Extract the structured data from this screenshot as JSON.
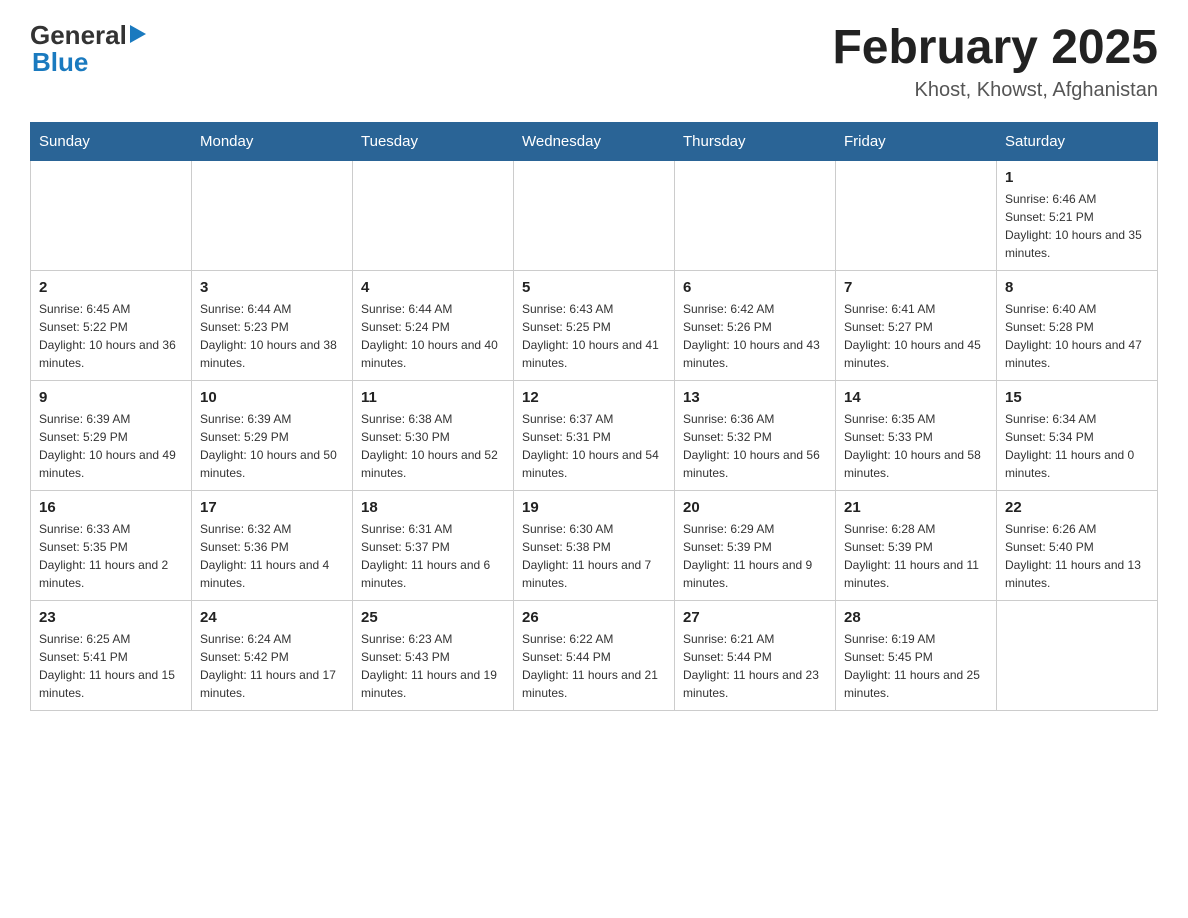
{
  "header": {
    "logo_general": "General",
    "logo_blue": "Blue",
    "title": "February 2025",
    "subtitle": "Khost, Khowst, Afghanistan"
  },
  "days_of_week": [
    "Sunday",
    "Monday",
    "Tuesday",
    "Wednesday",
    "Thursday",
    "Friday",
    "Saturday"
  ],
  "weeks": [
    {
      "days": [
        {
          "number": "",
          "info": ""
        },
        {
          "number": "",
          "info": ""
        },
        {
          "number": "",
          "info": ""
        },
        {
          "number": "",
          "info": ""
        },
        {
          "number": "",
          "info": ""
        },
        {
          "number": "",
          "info": ""
        },
        {
          "number": "1",
          "info": "Sunrise: 6:46 AM\nSunset: 5:21 PM\nDaylight: 10 hours and 35 minutes."
        }
      ]
    },
    {
      "days": [
        {
          "number": "2",
          "info": "Sunrise: 6:45 AM\nSunset: 5:22 PM\nDaylight: 10 hours and 36 minutes."
        },
        {
          "number": "3",
          "info": "Sunrise: 6:44 AM\nSunset: 5:23 PM\nDaylight: 10 hours and 38 minutes."
        },
        {
          "number": "4",
          "info": "Sunrise: 6:44 AM\nSunset: 5:24 PM\nDaylight: 10 hours and 40 minutes."
        },
        {
          "number": "5",
          "info": "Sunrise: 6:43 AM\nSunset: 5:25 PM\nDaylight: 10 hours and 41 minutes."
        },
        {
          "number": "6",
          "info": "Sunrise: 6:42 AM\nSunset: 5:26 PM\nDaylight: 10 hours and 43 minutes."
        },
        {
          "number": "7",
          "info": "Sunrise: 6:41 AM\nSunset: 5:27 PM\nDaylight: 10 hours and 45 minutes."
        },
        {
          "number": "8",
          "info": "Sunrise: 6:40 AM\nSunset: 5:28 PM\nDaylight: 10 hours and 47 minutes."
        }
      ]
    },
    {
      "days": [
        {
          "number": "9",
          "info": "Sunrise: 6:39 AM\nSunset: 5:29 PM\nDaylight: 10 hours and 49 minutes."
        },
        {
          "number": "10",
          "info": "Sunrise: 6:39 AM\nSunset: 5:29 PM\nDaylight: 10 hours and 50 minutes."
        },
        {
          "number": "11",
          "info": "Sunrise: 6:38 AM\nSunset: 5:30 PM\nDaylight: 10 hours and 52 minutes."
        },
        {
          "number": "12",
          "info": "Sunrise: 6:37 AM\nSunset: 5:31 PM\nDaylight: 10 hours and 54 minutes."
        },
        {
          "number": "13",
          "info": "Sunrise: 6:36 AM\nSunset: 5:32 PM\nDaylight: 10 hours and 56 minutes."
        },
        {
          "number": "14",
          "info": "Sunrise: 6:35 AM\nSunset: 5:33 PM\nDaylight: 10 hours and 58 minutes."
        },
        {
          "number": "15",
          "info": "Sunrise: 6:34 AM\nSunset: 5:34 PM\nDaylight: 11 hours and 0 minutes."
        }
      ]
    },
    {
      "days": [
        {
          "number": "16",
          "info": "Sunrise: 6:33 AM\nSunset: 5:35 PM\nDaylight: 11 hours and 2 minutes."
        },
        {
          "number": "17",
          "info": "Sunrise: 6:32 AM\nSunset: 5:36 PM\nDaylight: 11 hours and 4 minutes."
        },
        {
          "number": "18",
          "info": "Sunrise: 6:31 AM\nSunset: 5:37 PM\nDaylight: 11 hours and 6 minutes."
        },
        {
          "number": "19",
          "info": "Sunrise: 6:30 AM\nSunset: 5:38 PM\nDaylight: 11 hours and 7 minutes."
        },
        {
          "number": "20",
          "info": "Sunrise: 6:29 AM\nSunset: 5:39 PM\nDaylight: 11 hours and 9 minutes."
        },
        {
          "number": "21",
          "info": "Sunrise: 6:28 AM\nSunset: 5:39 PM\nDaylight: 11 hours and 11 minutes."
        },
        {
          "number": "22",
          "info": "Sunrise: 6:26 AM\nSunset: 5:40 PM\nDaylight: 11 hours and 13 minutes."
        }
      ]
    },
    {
      "days": [
        {
          "number": "23",
          "info": "Sunrise: 6:25 AM\nSunset: 5:41 PM\nDaylight: 11 hours and 15 minutes."
        },
        {
          "number": "24",
          "info": "Sunrise: 6:24 AM\nSunset: 5:42 PM\nDaylight: 11 hours and 17 minutes."
        },
        {
          "number": "25",
          "info": "Sunrise: 6:23 AM\nSunset: 5:43 PM\nDaylight: 11 hours and 19 minutes."
        },
        {
          "number": "26",
          "info": "Sunrise: 6:22 AM\nSunset: 5:44 PM\nDaylight: 11 hours and 21 minutes."
        },
        {
          "number": "27",
          "info": "Sunrise: 6:21 AM\nSunset: 5:44 PM\nDaylight: 11 hours and 23 minutes."
        },
        {
          "number": "28",
          "info": "Sunrise: 6:19 AM\nSunset: 5:45 PM\nDaylight: 11 hours and 25 minutes."
        },
        {
          "number": "",
          "info": ""
        }
      ]
    }
  ]
}
